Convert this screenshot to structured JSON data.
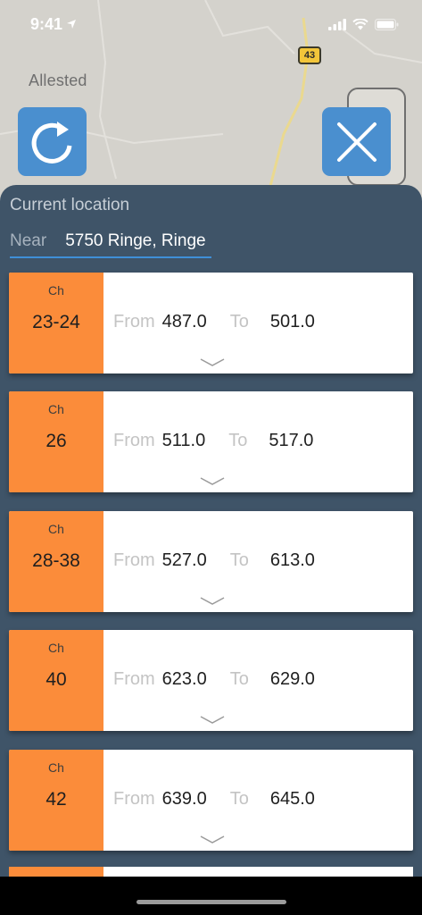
{
  "status_bar": {
    "time": "9:41",
    "icons": [
      "location-arrow-icon",
      "cellular-signal-icon",
      "wifi-icon",
      "battery-icon"
    ]
  },
  "map": {
    "place_label": "Allested",
    "road_number": "43"
  },
  "buttons": {
    "refresh": {
      "icon": "refresh-icon",
      "color": "#4a8fcf"
    },
    "close": {
      "icon": "close-icon",
      "color": "#4a8fcf"
    }
  },
  "panel": {
    "title": "Current location",
    "near_label": "Near",
    "near_value": "5750 Ringe, Ringe"
  },
  "channels": [
    {
      "ch_label": "Ch",
      "ch": "23-24",
      "from_label": "From",
      "from": "487.0",
      "to_label": "To",
      "to": "501.0"
    },
    {
      "ch_label": "Ch",
      "ch": "26",
      "from_label": "From",
      "from": "511.0",
      "to_label": "To",
      "to": "517.0"
    },
    {
      "ch_label": "Ch",
      "ch": "28-38",
      "from_label": "From",
      "from": "527.0",
      "to_label": "To",
      "to": "613.0"
    },
    {
      "ch_label": "Ch",
      "ch": "40",
      "from_label": "From",
      "from": "623.0",
      "to_label": "To",
      "to": "629.0"
    },
    {
      "ch_label": "Ch",
      "ch": "42",
      "from_label": "From",
      "from": "639.0",
      "to_label": "To",
      "to": "645.0"
    }
  ],
  "colors": {
    "panel_bg": "#3f5468",
    "channel_accent": "#fb8c3a",
    "input_underline": "#3f8fd8"
  }
}
